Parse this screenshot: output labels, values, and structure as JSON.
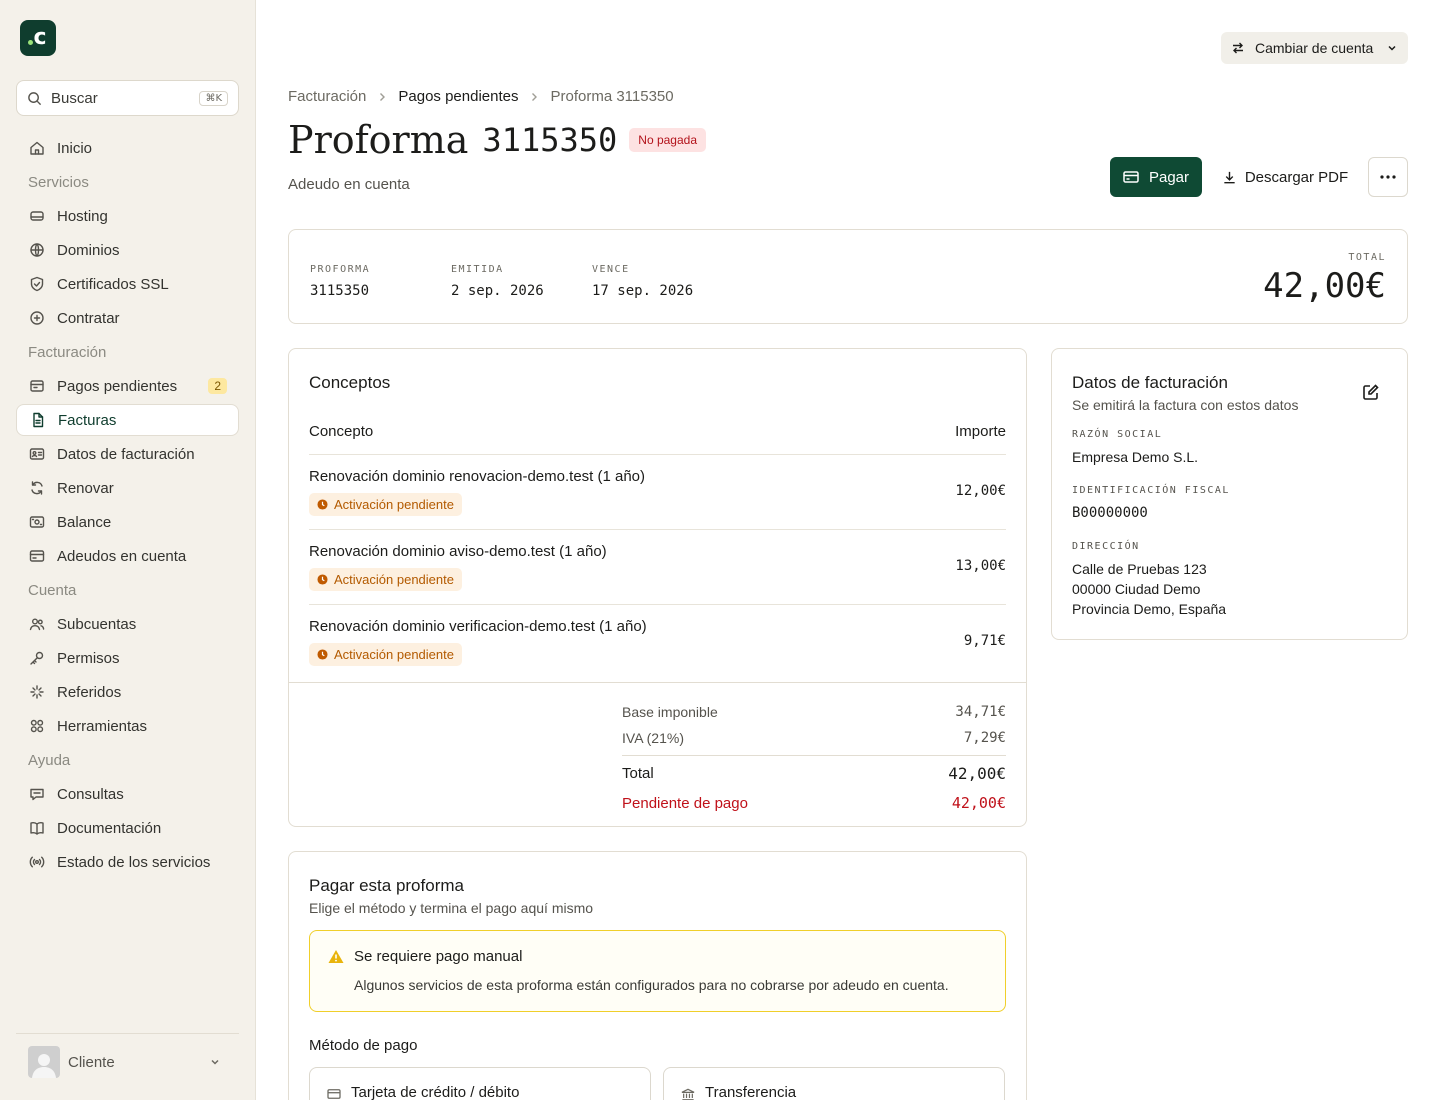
{
  "sidebar": {
    "search": {
      "placeholder": "Buscar",
      "shortcut": "⌘K"
    },
    "items": [
      {
        "type": "item",
        "label": "Inicio",
        "icon": "home-icon"
      },
      {
        "type": "section",
        "label": "Servicios"
      },
      {
        "type": "item",
        "label": "Hosting",
        "icon": "server-icon"
      },
      {
        "type": "item",
        "label": "Dominios",
        "icon": "globe-icon"
      },
      {
        "type": "item",
        "label": "Certificados SSL",
        "icon": "shield-icon"
      },
      {
        "type": "item",
        "label": "Contratar",
        "icon": "plus-circle-icon"
      },
      {
        "type": "section",
        "label": "Facturación"
      },
      {
        "type": "item",
        "label": "Pagos pendientes",
        "icon": "inbox-icon",
        "badge": "2"
      },
      {
        "type": "item",
        "label": "Facturas",
        "icon": "file-icon",
        "active": true
      },
      {
        "type": "item",
        "label": "Datos de facturación",
        "icon": "id-card-icon"
      },
      {
        "type": "item",
        "label": "Renovar",
        "icon": "refresh-icon"
      },
      {
        "type": "item",
        "label": "Balance",
        "icon": "wallet-icon"
      },
      {
        "type": "item",
        "label": "Adeudos en cuenta",
        "icon": "credit-card-icon"
      },
      {
        "type": "section",
        "label": "Cuenta"
      },
      {
        "type": "item",
        "label": "Subcuentas",
        "icon": "users-icon"
      },
      {
        "type": "item",
        "label": "Permisos",
        "icon": "key-icon"
      },
      {
        "type": "item",
        "label": "Referidos",
        "icon": "sparkles-icon"
      },
      {
        "type": "item",
        "label": "Herramientas",
        "icon": "grid-icon"
      },
      {
        "type": "section",
        "label": "Ayuda"
      },
      {
        "type": "item",
        "label": "Consultas",
        "icon": "chat-icon"
      },
      {
        "type": "item",
        "label": "Documentación",
        "icon": "book-icon"
      },
      {
        "type": "item",
        "label": "Estado de los servicios",
        "icon": "broadcast-icon"
      }
    ],
    "user": {
      "name": "Cliente"
    }
  },
  "header": {
    "switch_account": "Cambiar de cuenta"
  },
  "breadcrumb": [
    "Facturación",
    "Pagos pendientes",
    "Proforma 3115350"
  ],
  "page": {
    "title_word": "Proforma",
    "title_number": "3115350",
    "status": "No pagada",
    "subtitle": "Adeudo en cuenta",
    "pay_button": "Pagar",
    "pdf_button": "Descargar PDF"
  },
  "summary": {
    "proforma_label": "PROFORMA",
    "proforma_value": "3115350",
    "issued_label": "EMITIDA",
    "issued_value": "2 sep. 2026",
    "due_label": "VENCE",
    "due_value": "17 sep. 2026",
    "total_label": "TOTAL",
    "total_value": "42,00€"
  },
  "concepts": {
    "title": "Conceptos",
    "col_concept": "Concepto",
    "col_amount": "Importe",
    "rows": [
      {
        "desc": "Renovación dominio renovacion-demo.test (1 año)",
        "status": "Activación pendiente",
        "amount": "12,00€"
      },
      {
        "desc": "Renovación dominio aviso-demo.test (1 año)",
        "status": "Activación pendiente",
        "amount": "13,00€"
      },
      {
        "desc": "Renovación dominio verificacion-demo.test (1 año)",
        "status": "Activación pendiente",
        "amount": "9,71€"
      }
    ],
    "base_label": "Base imponible",
    "base_value": "34,71€",
    "vat_label": "IVA (21%)",
    "vat_value": "7,29€",
    "total_label": "Total",
    "total_value": "42,00€",
    "pending_label": "Pendiente de pago",
    "pending_value": "42,00€"
  },
  "billing": {
    "title": "Datos de facturación",
    "subtitle": "Se emitirá la factura con estos datos",
    "company_label": "RAZÓN SOCIAL",
    "company_value": "Empresa Demo S.L.",
    "tax_label": "IDENTIFICACIÓN FISCAL",
    "tax_value": "B00000000",
    "address_label": "DIRECCIÓN",
    "address_line1": "Calle de Pruebas 123",
    "address_line2": "00000 Ciudad Demo",
    "address_line3": "Provincia Demo, España"
  },
  "pay": {
    "title": "Pagar esta proforma",
    "subtitle": "Elige el método y termina el pago aquí mismo",
    "alert_title": "Se requiere pago manual",
    "alert_body": "Algunos servicios de esta proforma están configurados para no cobrarse por adeudo en cuenta.",
    "method_label": "Método de pago",
    "method_card": "Tarjeta de crédito / débito",
    "method_transfer": "Transferencia"
  },
  "colors": {
    "brand": "#0f4a34",
    "danger": "#c0111a",
    "warning": "#f0cf2a",
    "pending": "#b35a00"
  }
}
